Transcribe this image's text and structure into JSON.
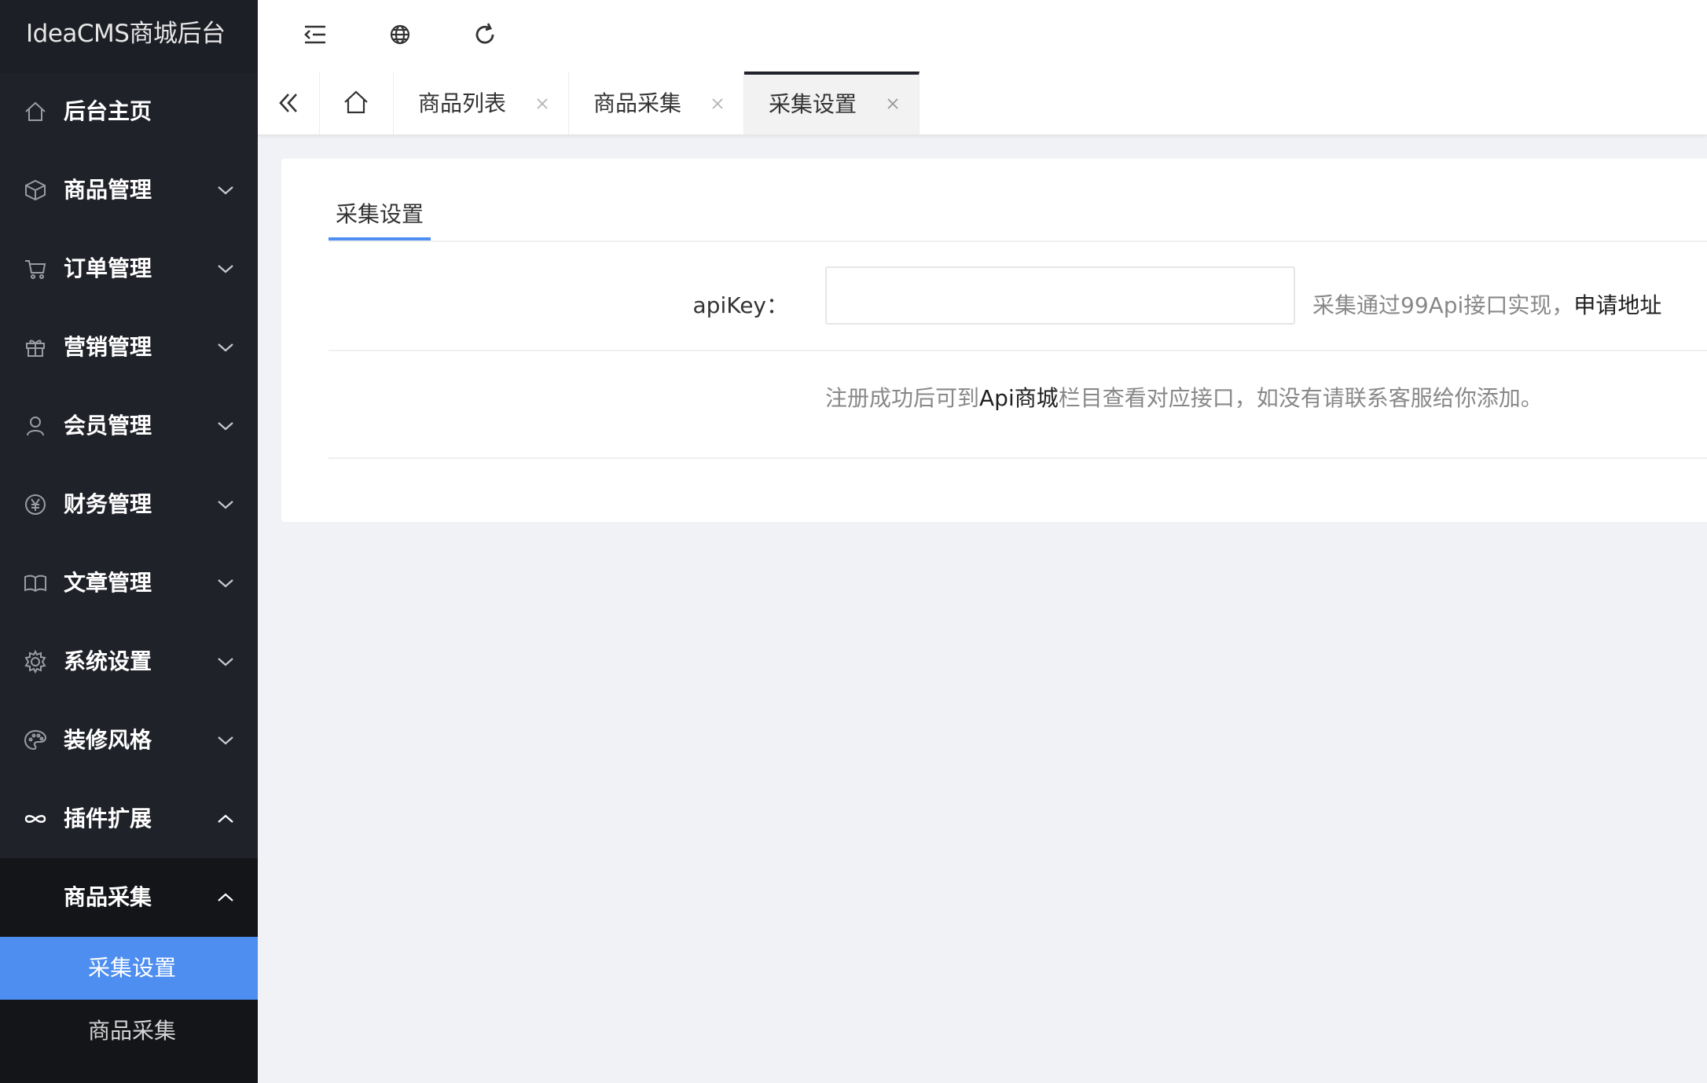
{
  "app": {
    "title": "IdeaCMS商城后台"
  },
  "sidebar": {
    "items": [
      {
        "label": "后台主页",
        "icon": "home-icon"
      },
      {
        "label": "商品管理",
        "icon": "box-icon"
      },
      {
        "label": "订单管理",
        "icon": "cart-icon"
      },
      {
        "label": "营销管理",
        "icon": "gift-icon"
      },
      {
        "label": "会员管理",
        "icon": "user-icon"
      },
      {
        "label": "财务管理",
        "icon": "yen-icon"
      },
      {
        "label": "文章管理",
        "icon": "book-icon"
      },
      {
        "label": "系统设置",
        "icon": "gear-icon"
      },
      {
        "label": "装修风格",
        "icon": "palette-icon"
      },
      {
        "label": "插件扩展",
        "icon": "plugin-icon"
      }
    ],
    "submenu": {
      "parent": "商品采集",
      "items": [
        {
          "label": "采集设置",
          "active": true
        },
        {
          "label": "商品采集",
          "active": false
        }
      ]
    }
  },
  "header": {
    "icons": [
      "menu-fold-icon",
      "globe-icon",
      "refresh-icon"
    ]
  },
  "tabs": [
    {
      "label": "商品列表"
    },
    {
      "label": "商品采集"
    },
    {
      "label": "采集设置",
      "active": true
    }
  ],
  "page": {
    "card_tab": "采集设置",
    "apikey_label": "apiKey：",
    "apikey_value": "",
    "hint_text": "采集通过99Api接口实现，",
    "hint_link": "申请地址",
    "note_prefix": "注册成功后可到",
    "note_highlight": "Api商城",
    "note_suffix": "栏目查看对应接口，如没有请联系客服给你添加。"
  },
  "colors": {
    "sidebar_bg": "#20222a",
    "accent": "#4d8ef0",
    "page_bg": "#f0f2f5"
  }
}
